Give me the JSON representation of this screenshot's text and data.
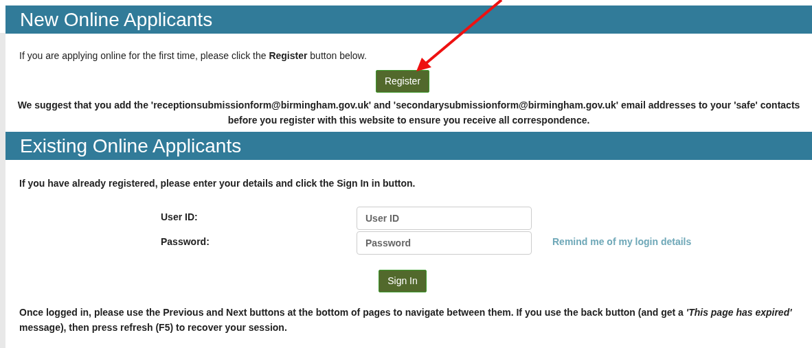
{
  "new_applicants": {
    "heading": "New Online Applicants",
    "intro": "If you are applying online for the first time, please click the **Register** button below.",
    "button": "Register",
    "notice": "We suggest that you add the 'receptionsubmissionform@birmingham.gov.uk' and 'secondarysubmissionform@birmingham.gov.uk' email addresses to your 'safe' contacts before you register with this website to ensure you receive all correspondence."
  },
  "existing_applicants": {
    "heading": "Existing Online Applicants",
    "intro": "If you have already registered, please enter your details and click the Sign In in button.",
    "fields": [
      {
        "label": "User ID:",
        "placeholder": "User ID"
      },
      {
        "label": "Password:",
        "placeholder": "Password"
      }
    ],
    "remind_link": "Remind me of my login details",
    "button": "Sign In",
    "note": "Once logged in, please use the Previous and Next buttons at the bottom of pages to navigate between them. If you use the back button (and get a *'This page has expired'* message), then press refresh (F5) to recover your session."
  }
}
